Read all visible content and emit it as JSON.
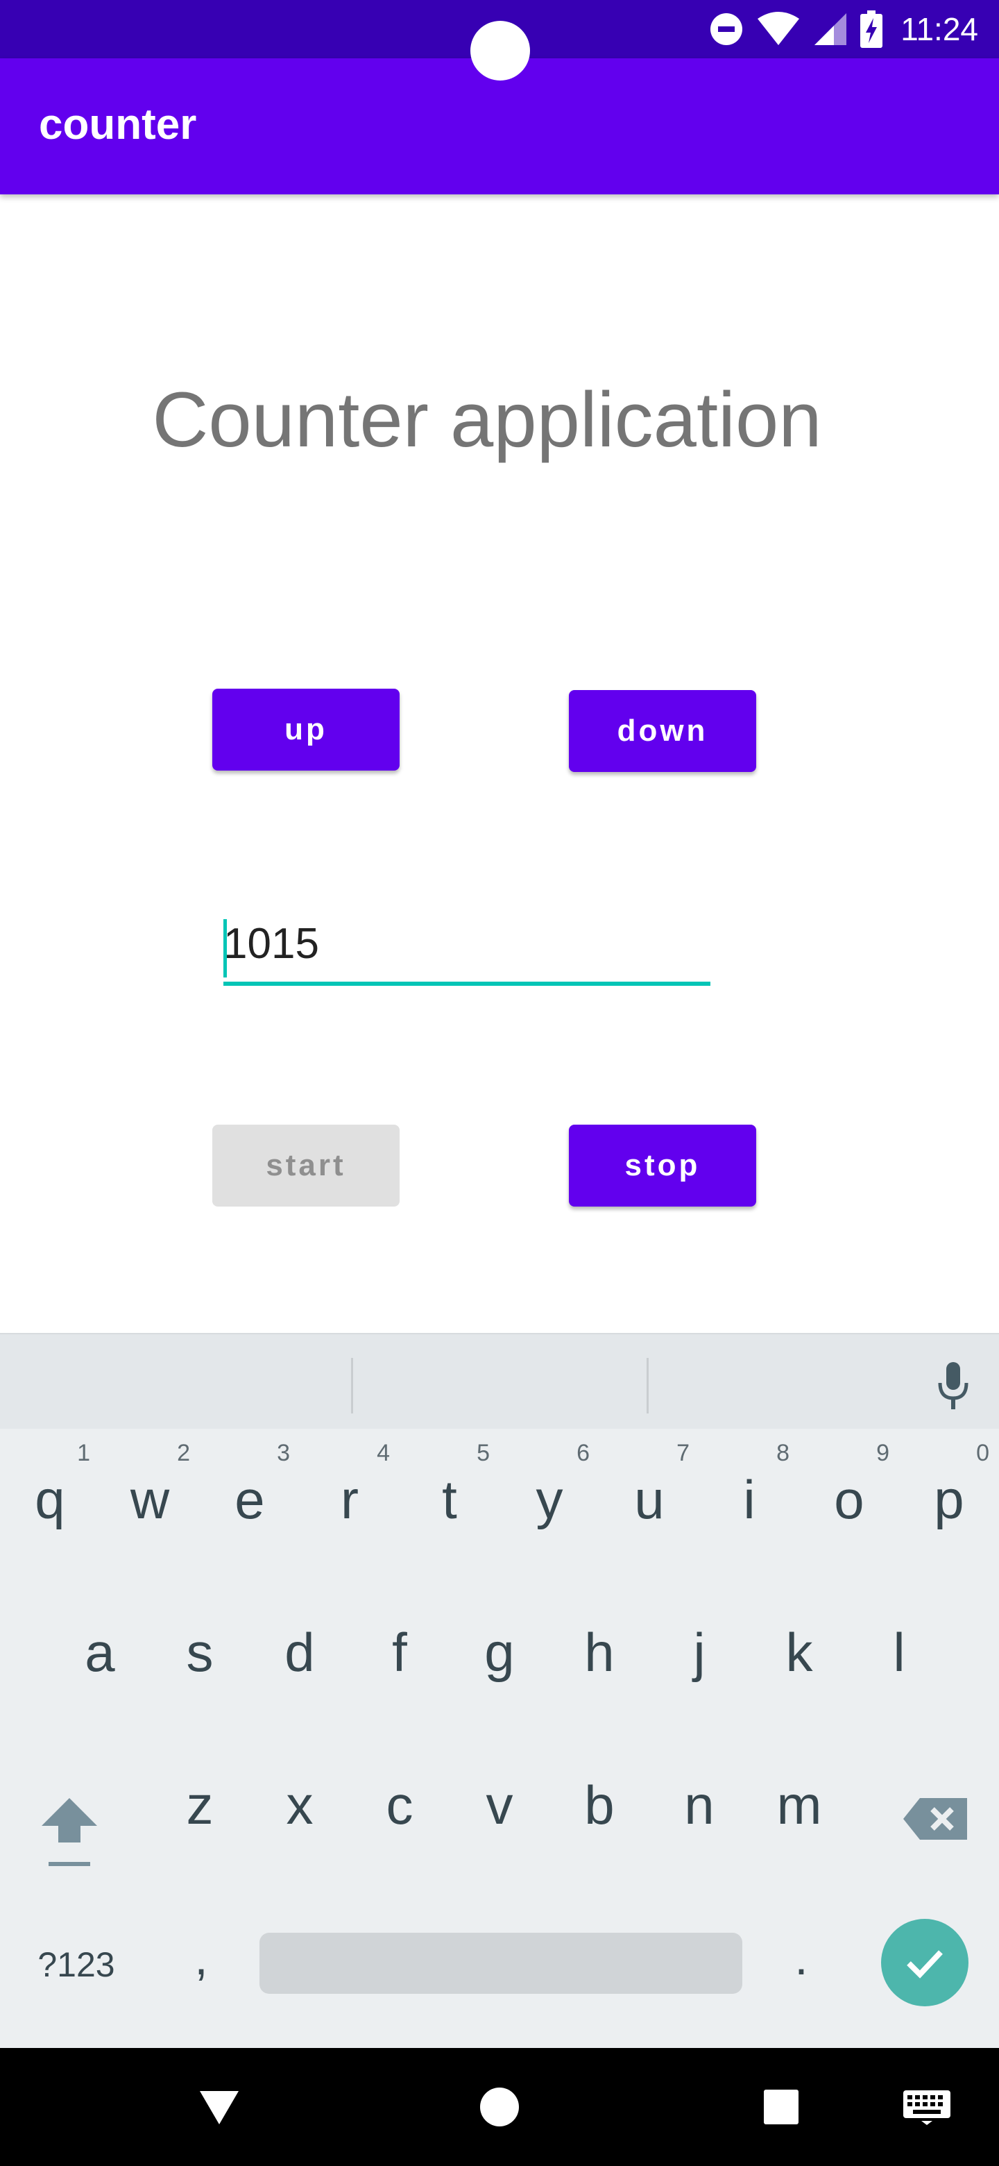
{
  "status_bar": {
    "time": "11:24",
    "icons": [
      "do-not-disturb-icon",
      "wifi-icon",
      "signal-icon",
      "battery-charging-icon"
    ]
  },
  "app_bar": {
    "title": "counter"
  },
  "main": {
    "heading": "Counter application",
    "up_label": "up",
    "down_label": "down",
    "counter_value": "1015",
    "start_label": "start",
    "stop_label": "stop",
    "start_enabled": false
  },
  "keyboard": {
    "mic_icon": "microphone-icon",
    "row1": [
      {
        "key": "q",
        "hint": "1"
      },
      {
        "key": "w",
        "hint": "2"
      },
      {
        "key": "e",
        "hint": "3"
      },
      {
        "key": "r",
        "hint": "4"
      },
      {
        "key": "t",
        "hint": "5"
      },
      {
        "key": "y",
        "hint": "6"
      },
      {
        "key": "u",
        "hint": "7"
      },
      {
        "key": "i",
        "hint": "8"
      },
      {
        "key": "o",
        "hint": "9"
      },
      {
        "key": "p",
        "hint": "0"
      }
    ],
    "row2": [
      "a",
      "s",
      "d",
      "f",
      "g",
      "h",
      "j",
      "k",
      "l"
    ],
    "row3": [
      "z",
      "x",
      "c",
      "v",
      "b",
      "n",
      "m"
    ],
    "symbols_label": "?123",
    "comma": ",",
    "period": ".",
    "accent_color": "#4db6ac"
  },
  "colors": {
    "status_bar": "#3700b3",
    "primary": "#6200ee",
    "field_accent": "#03c5b6",
    "disabled_button": "#e0e0e0"
  },
  "nav_bar": {
    "icons": [
      "back-icon",
      "home-icon",
      "recents-icon",
      "keyboard-switch-icon"
    ]
  }
}
